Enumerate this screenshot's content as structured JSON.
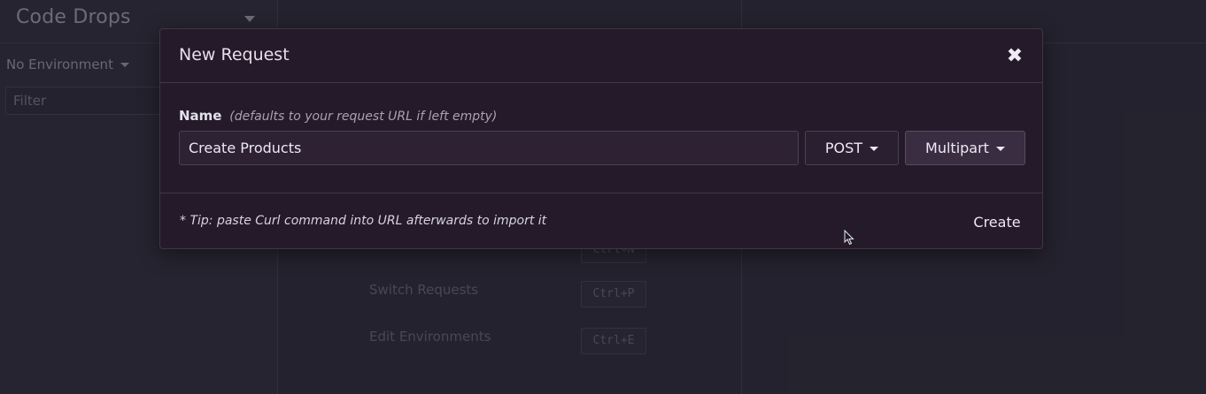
{
  "sidebar": {
    "workspace_title": "Code Drops",
    "environment_label": "No Environment",
    "filter_placeholder": "Filter"
  },
  "center": {
    "shortcuts": [
      {
        "label": "Switch Requests",
        "key": "Ctrl+P"
      },
      {
        "label": "Edit Environments",
        "key": "Ctrl+E"
      }
    ],
    "partial_key": "Ctrl+N"
  },
  "modal": {
    "title": "New Request",
    "close_symbol": "✖",
    "name_label": "Name",
    "name_hint": "(defaults to your request URL if left empty)",
    "name_value": "Create Products",
    "method": "POST",
    "body_type": "Multipart",
    "tip": "* Tip: paste Curl command into URL afterwards to import it",
    "create_label": "Create"
  },
  "colors": {
    "modal_bg": "#241a2a",
    "app_bg": "#2a2935",
    "text": "#ece8f2"
  }
}
